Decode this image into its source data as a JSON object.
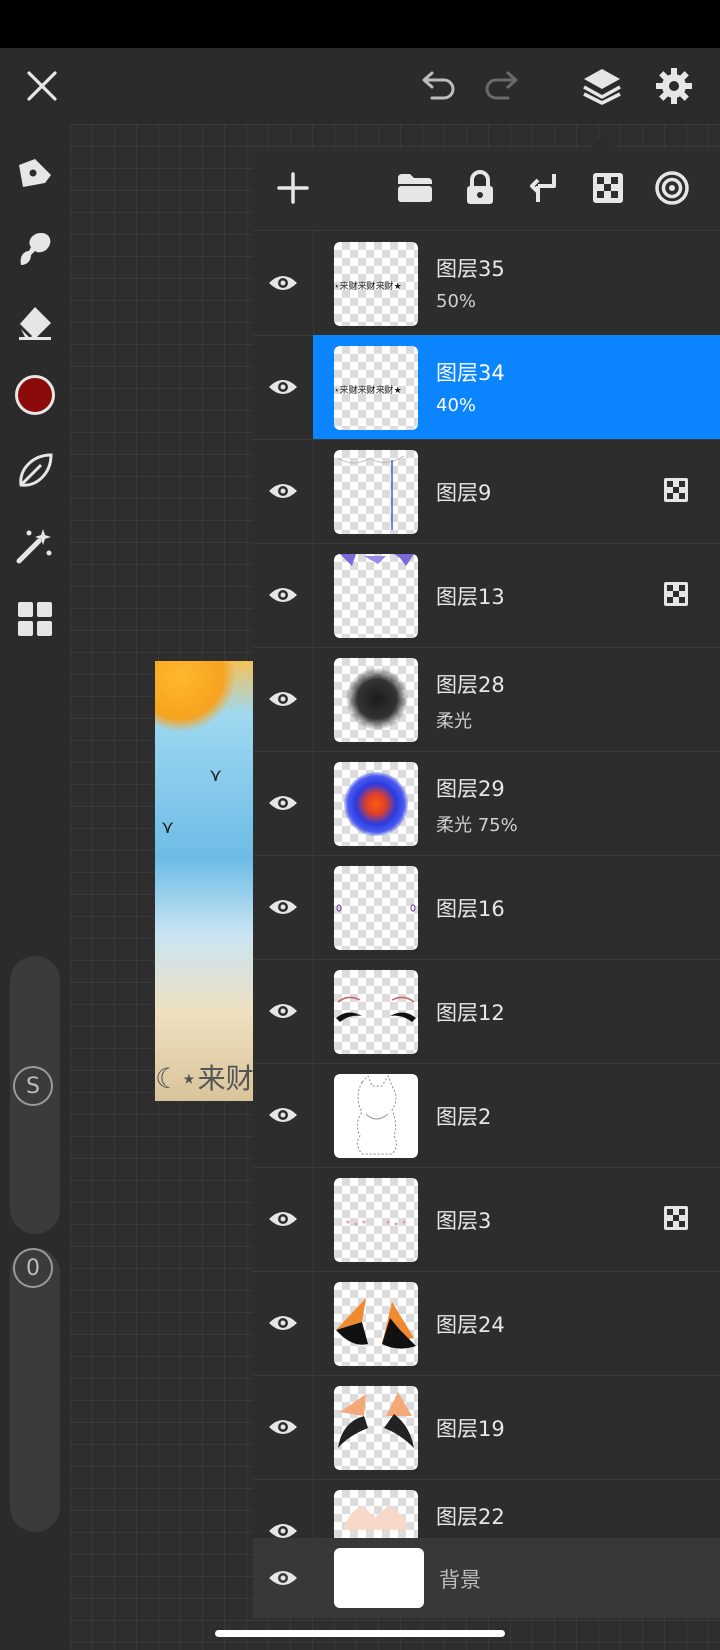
{
  "topbar": {
    "close_icon": "close-icon",
    "undo_icon": "undo-icon",
    "redo_icon": "redo-icon",
    "layers_icon": "layers-icon",
    "settings_icon": "gear-icon"
  },
  "toolbar": {
    "tools": [
      "pen-tool-icon",
      "smudge-tool-icon",
      "eraser-tool-icon",
      "color-swatch",
      "leaf-brush-icon",
      "magic-wand-icon",
      "grid-apps-icon"
    ],
    "current_color": "#8b0a0a",
    "size_badge": "S",
    "opacity_badge": "0"
  },
  "canvas": {
    "caption": "☾⋆来财"
  },
  "layers_panel": {
    "actions": [
      "add-layer-icon",
      "folder-icon",
      "lock-icon",
      "merge-down-icon",
      "alpha-lock-icon",
      "blend-mode-icon"
    ],
    "layers": [
      {
        "name": "图层35",
        "sub": "50%",
        "selected": false,
        "alpha_locked": false,
        "thumb": "text"
      },
      {
        "name": "图层34",
        "sub": "40%",
        "selected": true,
        "alpha_locked": false,
        "thumb": "text"
      },
      {
        "name": "图层9",
        "sub": "",
        "selected": false,
        "alpha_locked": true,
        "thumb": "lines"
      },
      {
        "name": "图层13",
        "sub": "",
        "selected": false,
        "alpha_locked": true,
        "thumb": "purple"
      },
      {
        "name": "图层28",
        "sub": "柔光",
        "selected": false,
        "alpha_locked": false,
        "thumb": "dark-blur"
      },
      {
        "name": "图层29",
        "sub": "柔光 75%",
        "selected": false,
        "alpha_locked": false,
        "thumb": "blue-orange"
      },
      {
        "name": "图层16",
        "sub": "",
        "selected": false,
        "alpha_locked": false,
        "thumb": "dots"
      },
      {
        "name": "图层12",
        "sub": "",
        "selected": false,
        "alpha_locked": false,
        "thumb": "eyes"
      },
      {
        "name": "图层2",
        "sub": "",
        "selected": false,
        "alpha_locked": false,
        "thumb": "sketch"
      },
      {
        "name": "图层3",
        "sub": "",
        "selected": false,
        "alpha_locked": true,
        "thumb": "blush"
      },
      {
        "name": "图层24",
        "sub": "",
        "selected": false,
        "alpha_locked": false,
        "thumb": "ears"
      },
      {
        "name": "图层19",
        "sub": "",
        "selected": false,
        "alpha_locked": false,
        "thumb": "ears2"
      },
      {
        "name": "图层22",
        "sub": "",
        "selected": false,
        "alpha_locked": false,
        "thumb": "skin"
      }
    ],
    "background": {
      "name": "背景"
    }
  },
  "thumb_texts": {
    "thumb_text_35": "⋆来财来财来财★",
    "thumb_text_34": "⋆来财来财来财★"
  },
  "colors": {
    "accent": "#0a84ff",
    "panel": "#2d2d2d",
    "bg": "#242424"
  }
}
